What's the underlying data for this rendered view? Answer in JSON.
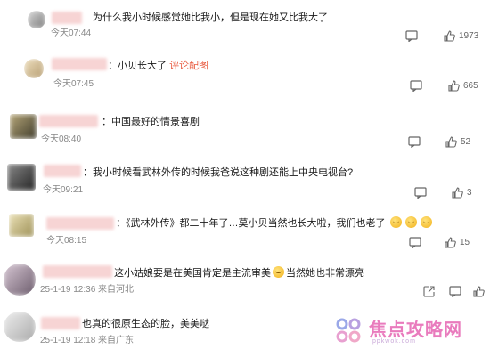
{
  "comments": [
    {
      "text": "为什么我小时候感觉她比我小，但是现在她又比我大了",
      "time": "今天07:44",
      "likes": "1973",
      "avatar_colors": [
        "#cfcfcf",
        "#7a7a7a"
      ],
      "icons": [
        "comment-icon",
        "like-icon"
      ]
    },
    {
      "text": "小贝长大了",
      "link": "评论配图",
      "prefix": "：",
      "time": "今天07:45",
      "likes": "665",
      "avatar_colors": [
        "#e8d2a8",
        "#b59c70"
      ],
      "icons": [
        "comment-icon",
        "like-icon"
      ]
    },
    {
      "prefix": "：",
      "text": "中国最好的情景喜剧",
      "time": "今天08:40",
      "likes": "52",
      "avatar_colors": [
        "#8a7a55",
        "#3d3a2a"
      ],
      "icons": [
        "comment-icon",
        "like-icon"
      ]
    },
    {
      "prefix": "：",
      "text": "我小时候看武林外传的时候我爸说这种剧还能上中央电视台?",
      "time": "今天09:21",
      "likes": "3",
      "avatar_colors": [
        "#5a5a5a",
        "#222222"
      ],
      "icons": [
        "comment-icon",
        "like-icon"
      ]
    },
    {
      "prefix": "：",
      "text": "《武林外传》都二十年了…莫小贝当然也长大啦，我们也老了",
      "time": "今天08:15",
      "likes": "15",
      "avatar_colors": [
        "#d8cc9a",
        "#9c8f55"
      ],
      "icons": [
        "comment-icon",
        "like-icon"
      ]
    },
    {
      "text_before": "这小姑娘要是在美国肯定是主流审美",
      "text_after": "当然她也非常漂亮",
      "time": "25-1-19 12:36 来自河北",
      "avatar_colors": [
        "#b9a8b5",
        "#6a5a6a"
      ],
      "icons": [
        "share-icon",
        "comment-icon",
        "like-icon"
      ]
    },
    {
      "text": "也真的很原生态的脸，美美哒",
      "time": "25-1-19 12:18 来自广东",
      "avatar_colors": [
        "#d8d8d8",
        "#a9a9a9"
      ]
    }
  ],
  "watermark": {
    "text": "焦点攻略网",
    "sub": "ppkwok.com",
    "color": "#e97bbd"
  }
}
